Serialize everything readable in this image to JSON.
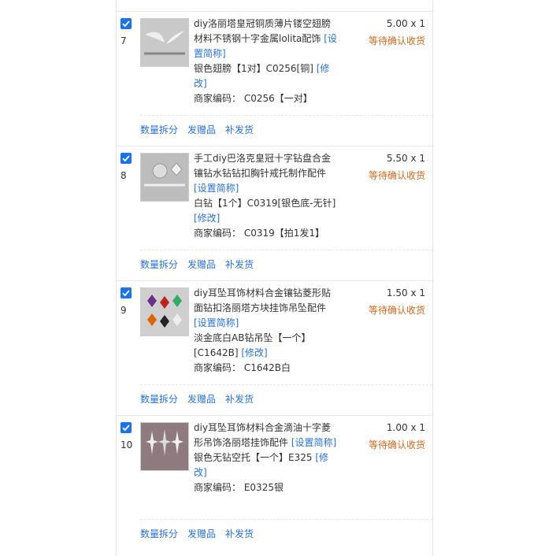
{
  "items": [
    {
      "index": "7",
      "title": "diy洛丽塔皇冠铜质薄片镂空翅膀材料不锈钢十字金属lolita配饰",
      "set_short": "[设置简称]",
      "sku": "银色翅膀【1对】C0256[铜]",
      "modify": "[修改]",
      "code_label": "商家编码：",
      "code": "C0256【一对】",
      "qty": "5.00 x 1",
      "status": "等待确认收货",
      "actions": [
        "数量拆分",
        "发赠品",
        "补发货"
      ]
    },
    {
      "index": "8",
      "title": "手工diy巴洛克皇冠十字钻盘合金镶钻水钻钻扣胸针戒托制作配件",
      "set_short": "[设置简称]",
      "sku": "白钻【1个】C0319[银色底-无针]",
      "modify": "[修改]",
      "code_label": "商家编码：",
      "code": "C0319【拍1发1】",
      "qty": "5.50 x 1",
      "status": "等待确认收货",
      "actions": [
        "数量拆分",
        "发赠品",
        "补发货"
      ]
    },
    {
      "index": "9",
      "title": "diy耳坠耳饰材料合金镶钻菱形贴面钻扣洛丽塔方块挂饰吊坠配件",
      "set_short": "[设置简称]",
      "sku": "淡金底白AB钻吊坠【一个】[C1642B]",
      "modify": "[修改]",
      "code_label": "商家编码：",
      "code": "C1642B白",
      "qty": "1.50 x 1",
      "status": "等待确认收货",
      "actions": [
        "数量拆分",
        "发赠品",
        "补发货"
      ]
    },
    {
      "index": "10",
      "title": "diy耳坠耳饰材料合金滴油十字菱形吊饰洛丽塔挂饰配件",
      "set_short": "[设置简称]",
      "sku": "银色无钻空托【一个】E325",
      "modify": "[修改]",
      "code_label": "商家编码：",
      "code": "E0325银",
      "qty": "1.00 x 1",
      "status": "等待确认收货",
      "actions": [
        "数量拆分",
        "发赠品",
        "补发货"
      ]
    }
  ]
}
